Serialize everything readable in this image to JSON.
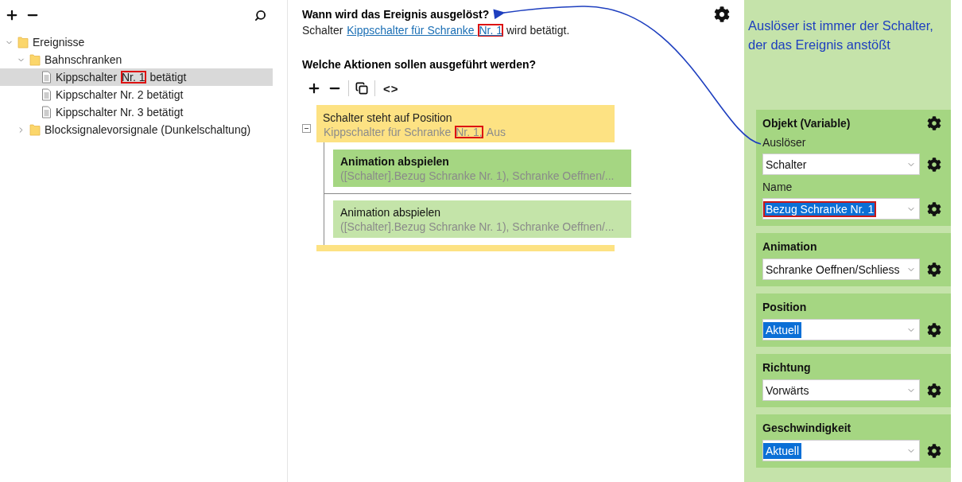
{
  "tree": [
    {
      "label": [
        {
          "text": "Ereignisse",
          "marked": false
        }
      ],
      "kind": "folder",
      "expanded": true,
      "selected": false,
      "children": [
        {
          "label": [
            {
              "text": "Bahnschranken",
              "marked": false
            }
          ],
          "kind": "folder",
          "expanded": true,
          "selected": false,
          "children": [
            {
              "label": [
                {
                  "text": "Kippschalter ",
                  "marked": false
                },
                {
                  "text": "Nr. 1",
                  "marked": true
                },
                {
                  "text": " betätigt",
                  "marked": false
                }
              ],
              "kind": "document",
              "selected": true
            },
            {
              "label": [
                {
                  "text": "Kippschalter Nr. 2 betätigt",
                  "marked": false
                }
              ],
              "kind": "document",
              "selected": false
            },
            {
              "label": [
                {
                  "text": "Kippschalter Nr. 3 betätigt",
                  "marked": false
                }
              ],
              "kind": "document",
              "selected": false
            }
          ]
        },
        {
          "label": [
            {
              "text": "Blocksignalevorsignale (Dunkelschaltung)",
              "marked": false
            }
          ],
          "kind": "folder",
          "expanded": false,
          "selected": false
        }
      ]
    }
  ],
  "trigger": {
    "heading": "Wann wird das Ereignis ausgelöst?",
    "before": "Schalter ",
    "link": [
      {
        "text": "Kippschalter für Schranke ",
        "marked": false
      },
      {
        "text": "Nr. 1",
        "marked": true
      }
    ],
    "after": " wird betätigt."
  },
  "actions_heading": "Welche Aktionen sollen ausgeführt werden?",
  "code_button": "<>",
  "condition": {
    "title": "Schalter steht auf Position",
    "detail": [
      {
        "text": "Kippschalter für Schranke ",
        "marked": false
      },
      {
        "text": "Nr. 1,",
        "marked": true
      },
      {
        "text": " Aus",
        "marked": false
      }
    ],
    "expanded": true,
    "actions": [
      {
        "title": "Animation abspielen",
        "detail": "([Schalter].Bezug Schranke Nr. 1), Schranke Oeffnen/...",
        "selected": true
      },
      {
        "title": "Animation abspielen",
        "detail": "([Schalter].Bezug Schranke Nr. 1), Schranke Oeffnen/...",
        "selected": false
      }
    ]
  },
  "annotation": "Auslöser ist immer der Schalter, der das Ereignis anstößt",
  "properties": [
    {
      "title": "Objekt (Variable)",
      "gear": true,
      "fields": [
        {
          "label": "Auslöser",
          "value": "Schalter",
          "selected": false,
          "marked": false
        },
        {
          "label": "Name",
          "value": "Bezug Schranke Nr. 1",
          "selected": true,
          "marked": true
        }
      ]
    },
    {
      "title": "Animation",
      "gear": false,
      "fields": [
        {
          "value": "Schranke Oeffnen/Schliess",
          "selected": false,
          "marked": false
        }
      ]
    },
    {
      "title": "Position",
      "gear": false,
      "fields": [
        {
          "value": "Aktuell",
          "selected": true,
          "marked": false
        }
      ]
    },
    {
      "title": "Richtung",
      "gear": false,
      "fields": [
        {
          "value": "Vorwärts",
          "selected": false,
          "marked": false
        }
      ]
    },
    {
      "title": "Geschwindigkeit",
      "gear": false,
      "fields": [
        {
          "value": "Aktuell",
          "selected": true,
          "marked": false
        }
      ]
    }
  ]
}
